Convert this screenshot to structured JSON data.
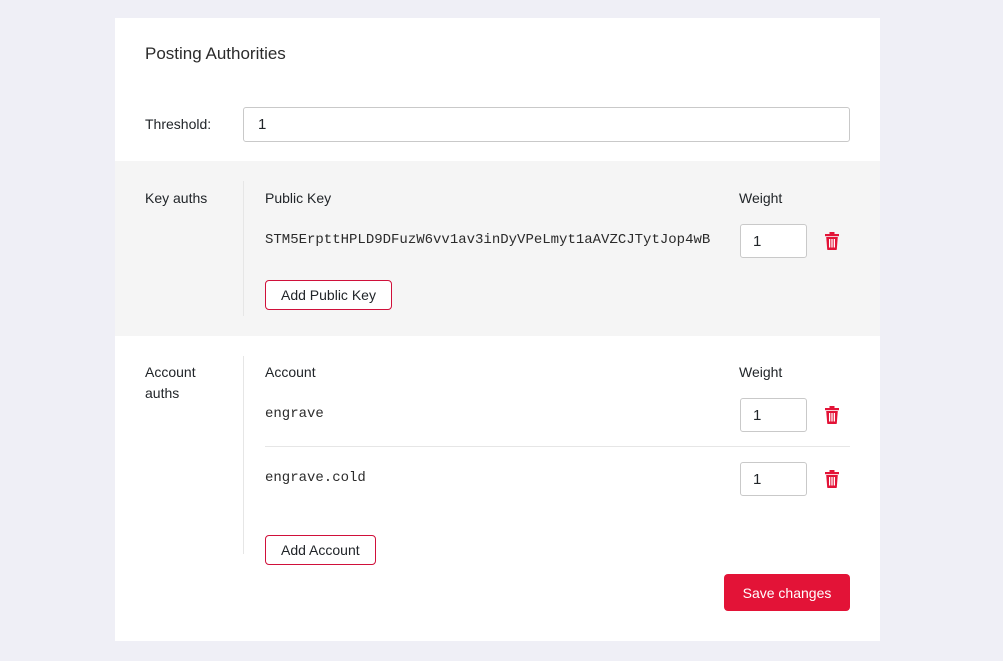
{
  "title": "Posting Authorities",
  "threshold": {
    "label": "Threshold:",
    "value": "1"
  },
  "key_auths": {
    "label": "Key auths",
    "col_key": "Public Key",
    "col_weight": "Weight",
    "items": [
      {
        "key": "STM5ErpttHPLD9DFuzW6vv1av3inDyVPeLmyt1aAVZCJTytJop4wB",
        "weight": "1"
      }
    ],
    "add_label": "Add Public Key"
  },
  "account_auths": {
    "label": "Account auths",
    "col_account": "Account",
    "col_weight": "Weight",
    "items": [
      {
        "account": "engrave",
        "weight": "1"
      },
      {
        "account": "engrave.cold",
        "weight": "1"
      }
    ],
    "add_label": "Add Account"
  },
  "save_label": "Save changes",
  "colors": {
    "accent": "#e31337",
    "panel_bg": "#f5f5f5",
    "page_bg": "#efeff6"
  },
  "icons": {
    "delete": "trash-icon"
  }
}
